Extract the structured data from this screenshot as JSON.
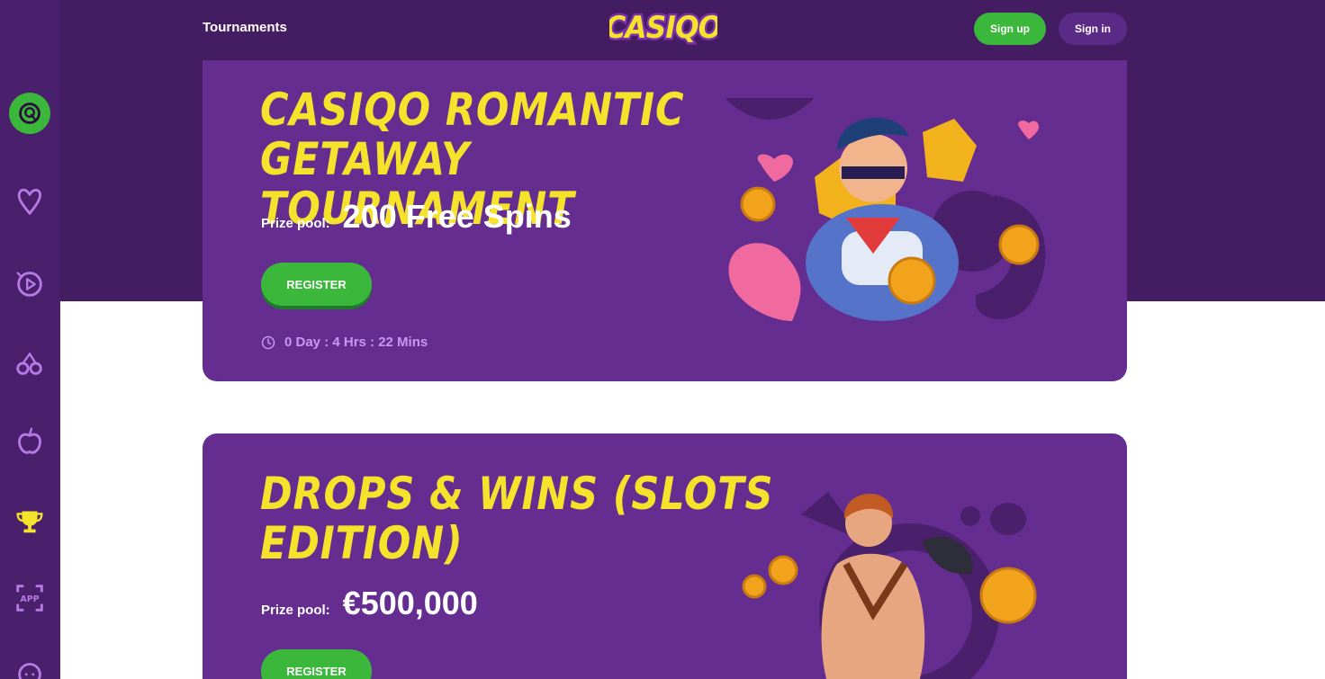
{
  "header": {
    "nav_tournaments": "Tournaments",
    "logo_text": "CASIQO",
    "sign_up": "Sign up",
    "sign_in": "Sign in"
  },
  "sidebar": {
    "items": [
      {
        "icon": "casiqo-q-icon",
        "active": true
      },
      {
        "icon": "heart-icon",
        "active": false
      },
      {
        "icon": "play-circle-icon",
        "active": false
      },
      {
        "icon": "cherries-icon",
        "active": false
      },
      {
        "icon": "apple-icon",
        "active": false
      },
      {
        "icon": "trophy-icon",
        "active": false
      },
      {
        "icon": "app-icon",
        "active": false
      },
      {
        "icon": "chat-icon",
        "active": false
      }
    ]
  },
  "tournaments": [
    {
      "title": "CASIQO ROMANTIC GETAWAY TOURNAMENT",
      "prize_label": "Prize pool:",
      "prize_value": "200 Free Spins",
      "register_label": "REGISTER",
      "countdown": "0 Day : 4 Hrs : 22 Mins"
    },
    {
      "title": "DROPS & WINS (SLOTS EDITION)",
      "prize_label": "Prize pool:",
      "prize_value": "€500,000",
      "register_label": "REGISTER"
    }
  ],
  "colors": {
    "page_dark": "#441c62",
    "sidebar": "#4a1f6b",
    "card": "#662d91",
    "title_yellow": "#f5e22a",
    "green": "#3bb83b",
    "timer": "#c799ee"
  }
}
